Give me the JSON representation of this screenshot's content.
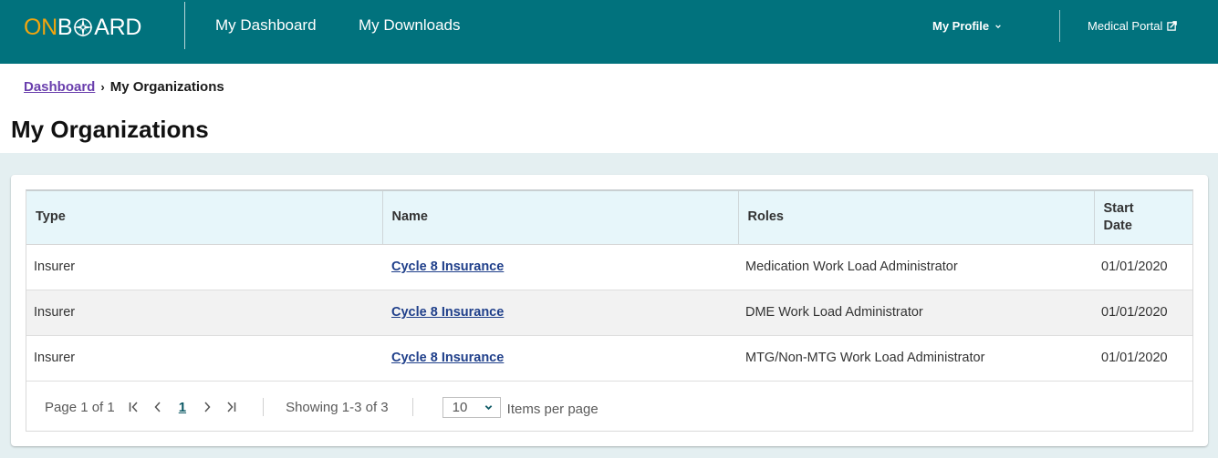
{
  "header": {
    "logo": {
      "part1": "ON",
      "part2a": "B",
      "part2b": "ARD"
    },
    "nav": [
      {
        "label": "My Dashboard"
      },
      {
        "label": "My Downloads"
      }
    ],
    "profile_label": "My Profile",
    "portal_label": "Medical Portal",
    "colors": {
      "bar": "#01727d",
      "logo_accent": "#f1a50f"
    }
  },
  "breadcrumb": {
    "items": [
      {
        "label": "Dashboard",
        "link": true
      },
      {
        "label": "My Organizations",
        "link": false
      }
    ],
    "separator": "›"
  },
  "page": {
    "title": "My Organizations"
  },
  "table": {
    "columns": [
      "Type",
      "Name",
      "Roles",
      "Start Date"
    ],
    "rows": [
      {
        "type": "Insurer",
        "name": "Cycle 8 Insurance",
        "roles": "Medication Work Load Administrator",
        "start_date": "01/01/2020"
      },
      {
        "type": "Insurer",
        "name": "Cycle 8 Insurance",
        "roles": "DME Work Load Administrator",
        "start_date": "01/01/2020"
      },
      {
        "type": "Insurer",
        "name": "Cycle 8 Insurance",
        "roles": "MTG/Non-MTG Work Load Administrator",
        "start_date": "01/01/2020"
      }
    ]
  },
  "pagination": {
    "page_label": "Page 1 of 1",
    "current_page": "1",
    "showing": "Showing 1-3 of 3",
    "per_page_value": "10",
    "per_page_label": "Items per page"
  }
}
